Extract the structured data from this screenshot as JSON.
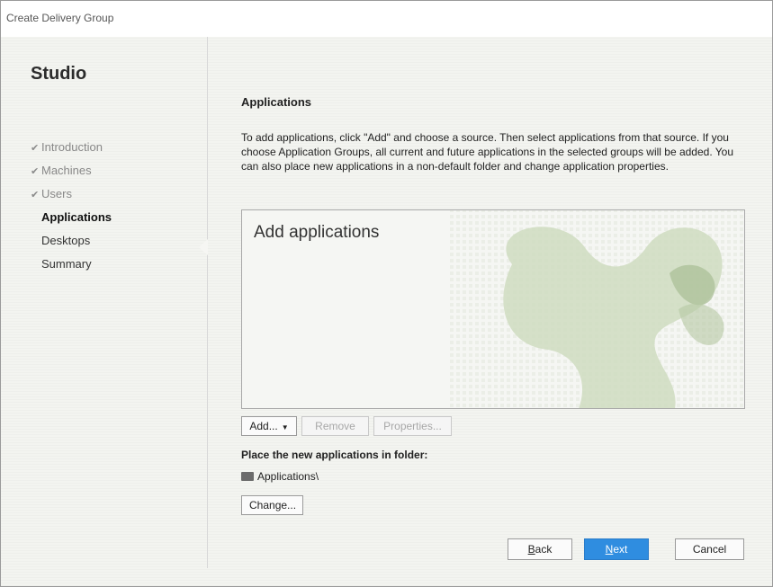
{
  "window": {
    "title": "Create Delivery Group"
  },
  "sidebar": {
    "brand": "Studio",
    "steps": [
      {
        "label": "Introduction",
        "state": "done"
      },
      {
        "label": "Machines",
        "state": "done"
      },
      {
        "label": "Users",
        "state": "done"
      },
      {
        "label": "Applications",
        "state": "active"
      },
      {
        "label": "Desktops",
        "state": "pending"
      },
      {
        "label": "Summary",
        "state": "pending"
      }
    ],
    "check_glyph": "✔"
  },
  "main": {
    "section_title": "Applications",
    "description": "To add applications, click \"Add\" and choose a source. Then select applications from that source. If you choose Application Groups, all current and future applications in the selected groups will be added. You can also place new applications in a non-default folder and change application properties.",
    "panel_title": "Add applications",
    "buttons": {
      "add": "Add...",
      "remove": "Remove",
      "properties": "Properties..."
    },
    "folder_label": "Place the new applications in folder:",
    "folder_path": "Applications\\",
    "change_button": "Change..."
  },
  "footer": {
    "back_accel": "B",
    "back_rest": "ack",
    "next_accel": "N",
    "next_rest": "ext",
    "cancel": "Cancel"
  },
  "colors": {
    "accent": "#2f8de0",
    "watermark": "#cfdcc0"
  },
  "icons": {
    "check": "check-icon",
    "dropdown": "chevron-down-icon",
    "folder": "folder-icon"
  }
}
